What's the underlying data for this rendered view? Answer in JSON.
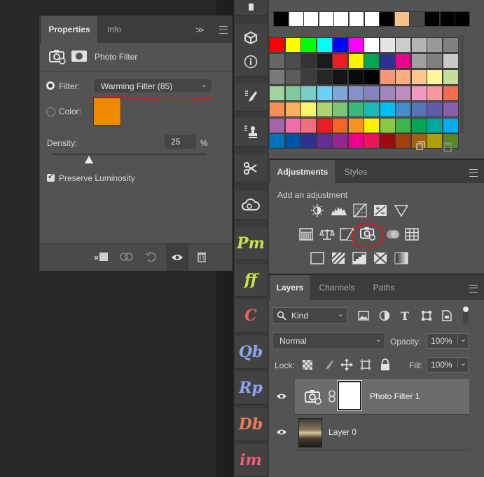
{
  "properties": {
    "tabs": [
      "Properties",
      "Info"
    ],
    "header_title": "Photo Filter",
    "filter_label": "Filter:",
    "filter_value": "Warming Filter (85)",
    "color_label": "Color:",
    "color_swatch": "#ee8a00",
    "density_label": "Density:",
    "density_value": "25",
    "density_unit": "%",
    "density_fraction": 0.25,
    "preserve_label": "Preserve Luminosity",
    "preserve_checked": true
  },
  "swatches": {
    "top_row": [
      "#000000",
      "#ffffff",
      "#ffffff",
      "#ffffff",
      "#ffffff",
      "#ffffff",
      "#ffffff",
      "#000000",
      "#f5c28c",
      "#4a4a4a",
      "#000000",
      "#000000",
      "#000000"
    ],
    "grid": [
      [
        "#ff0000",
        "#ffff00",
        "#00ff00",
        "#00ffff",
        "#0000ff",
        "#ff00ff",
        "#ffffff",
        "#e6e6e6",
        "#cccccc",
        "#b3b3b3",
        "#999999",
        "#808080"
      ],
      [
        "#666666",
        "#4d4d4d",
        "#333333",
        "#1a1a1a",
        "#ed1c24",
        "#fff200",
        "#00a651",
        "#2e3192",
        "#ec008c",
        "#a0a0a0",
        "#808080",
        "#c8c8c8"
      ],
      [
        "#7a7a7a",
        "#5c5c5c",
        "#3d3d3d",
        "#262626",
        "#141414",
        "#0a0a0a",
        "#000000",
        "#f7977a",
        "#f9ad81",
        "#fdc68a",
        "#fff79a",
        "#c4df9b"
      ],
      [
        "#a3d39c",
        "#82ca9d",
        "#7bcdc8",
        "#6ecff6",
        "#7ea7d8",
        "#8493ca",
        "#8882be",
        "#a187be",
        "#bc8dbf",
        "#f49ac2",
        "#f6989d",
        "#f26c4f"
      ],
      [
        "#f68e56",
        "#fbaf5d",
        "#fff568",
        "#acd372",
        "#7cc576",
        "#3bb878",
        "#1abbb4",
        "#00bff3",
        "#438ccb",
        "#5574b9",
        "#605ca8",
        "#855fa8"
      ],
      [
        "#a763a8",
        "#f06eaa",
        "#f26d7d",
        "#ed1c24",
        "#f26522",
        "#f7941d",
        "#fff200",
        "#8dc63f",
        "#39b54a",
        "#00a651",
        "#00a99d",
        "#00aeef"
      ],
      [
        "#0072bc",
        "#0054a6",
        "#2e3192",
        "#662d91",
        "#92278f",
        "#ec008c",
        "#ed145b",
        "#9e0b0f",
        "#a0410d",
        "#a3620a",
        "#aba000",
        "#598527"
      ]
    ]
  },
  "adjustments": {
    "tabs": [
      "Adjustments",
      "Styles"
    ],
    "hint": "Add an adjustment"
  },
  "layers": {
    "tabs": [
      "Layers",
      "Channels",
      "Paths"
    ],
    "kind_label": "Kind",
    "blend_mode": "Normal",
    "opacity_label": "Opacity:",
    "opacity_value": "100%",
    "lock_label": "Lock:",
    "fill_label": "Fill:",
    "fill_value": "100%",
    "items": [
      {
        "name": "Photo Filter 1",
        "visible": true,
        "selected": true
      },
      {
        "name": "Layer 0",
        "visible": true,
        "selected": false
      }
    ]
  },
  "plugins": [
    "Pm",
    "ff",
    "C",
    "Qb",
    "Rp",
    "Db",
    "im"
  ],
  "plugin_colors": [
    "#c8e24a",
    "#c8e24a",
    "#f25c5c",
    "#8ea4f0",
    "#8ea4f0",
    "#f07a5a",
    "#f25c7a"
  ],
  "annotation_color": "#d11a1a"
}
